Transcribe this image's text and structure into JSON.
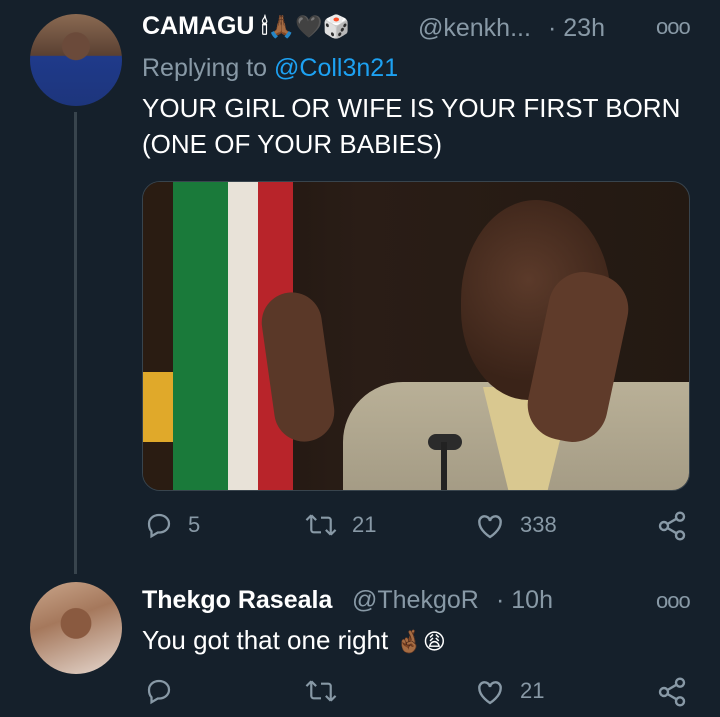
{
  "tweet1": {
    "name": "CAMAGU",
    "name_emojis": "🕯🙏🏾🖤🎲",
    "handle": "@kenkh...",
    "time": "· 23h",
    "reply_label": "Replying to",
    "reply_to": "@Coll3n21",
    "text_line1": "YOUR GIRL OR WIFE IS YOUR FIRST BORN",
    "text_line2": "(ONE OF YOUR BABIES)",
    "replies": "5",
    "retweets": "21",
    "likes": "338"
  },
  "tweet2": {
    "name": "Thekgo Raseala",
    "handle": "@ThekgoR",
    "time": "· 10h",
    "text": "You got that one right",
    "text_emojis": "🤞🏾😩",
    "replies": "",
    "retweets": "",
    "likes": "21"
  },
  "icons": [
    "more-icon",
    "reply-icon",
    "retweet-icon",
    "like-icon",
    "share-icon"
  ],
  "colors": {
    "background": "#15202b",
    "muted": "#8899a6",
    "link": "#1da1f2",
    "divider": "#38444d"
  }
}
